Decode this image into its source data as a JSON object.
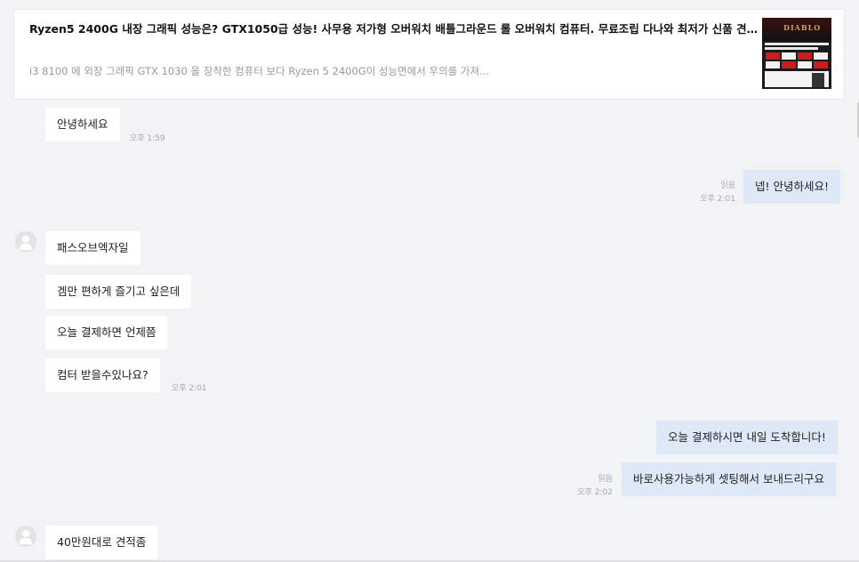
{
  "preview": {
    "title": "Ryzen5 2400G 내장 그래픽 성능은? GTX1050급 성능! 사무용 저가형 오버워치 배틀그라운드 롤 오버워치 컴퓨터. 무료조립 다나와 최저가 신품 견적...",
    "description": "i3 8100 에 외장 그래픽 GTX 1030 을 장착한 컴퓨터 보다 Ryzen 5 2400G이 성능면에서 우의를 가져...",
    "thumbnail_icon": "product-thumbnail-image",
    "thumbnail_logo": "DIABLO"
  },
  "messages": [
    {
      "id": "m1",
      "side": "received",
      "text": "안녕하세요",
      "time": "오후 1:59"
    },
    {
      "id": "m2",
      "side": "sent",
      "text": "넵! 안녕하세요!",
      "read": "읽음",
      "time": "오후 2:01"
    },
    {
      "id": "m3",
      "side": "received",
      "text": "패스오브엑자일"
    },
    {
      "id": "m4",
      "side": "received",
      "text": "겜만 편하게 즐기고 싶은데"
    },
    {
      "id": "m5",
      "side": "received",
      "text": "오늘 결제하면 언제쯤"
    },
    {
      "id": "m6",
      "side": "received",
      "text": "컴터 받을수있나요?",
      "time": "오후 2:01"
    },
    {
      "id": "m7",
      "side": "sent",
      "text": "오늘 결제하시면 내일 도착합니다!"
    },
    {
      "id": "m8",
      "side": "sent",
      "text": "바로사용가능하게 셋팅해서 보내드리구요",
      "read": "읽음",
      "time": "오후 2:02"
    },
    {
      "id": "m9",
      "side": "received",
      "text": "40만원대로 견적좀"
    }
  ],
  "colors": {
    "background": "#f2f3f5",
    "received_bubble": "#ffffff",
    "sent_bubble": "#dfe8f6",
    "meta_text": "#a9a9a9"
  }
}
